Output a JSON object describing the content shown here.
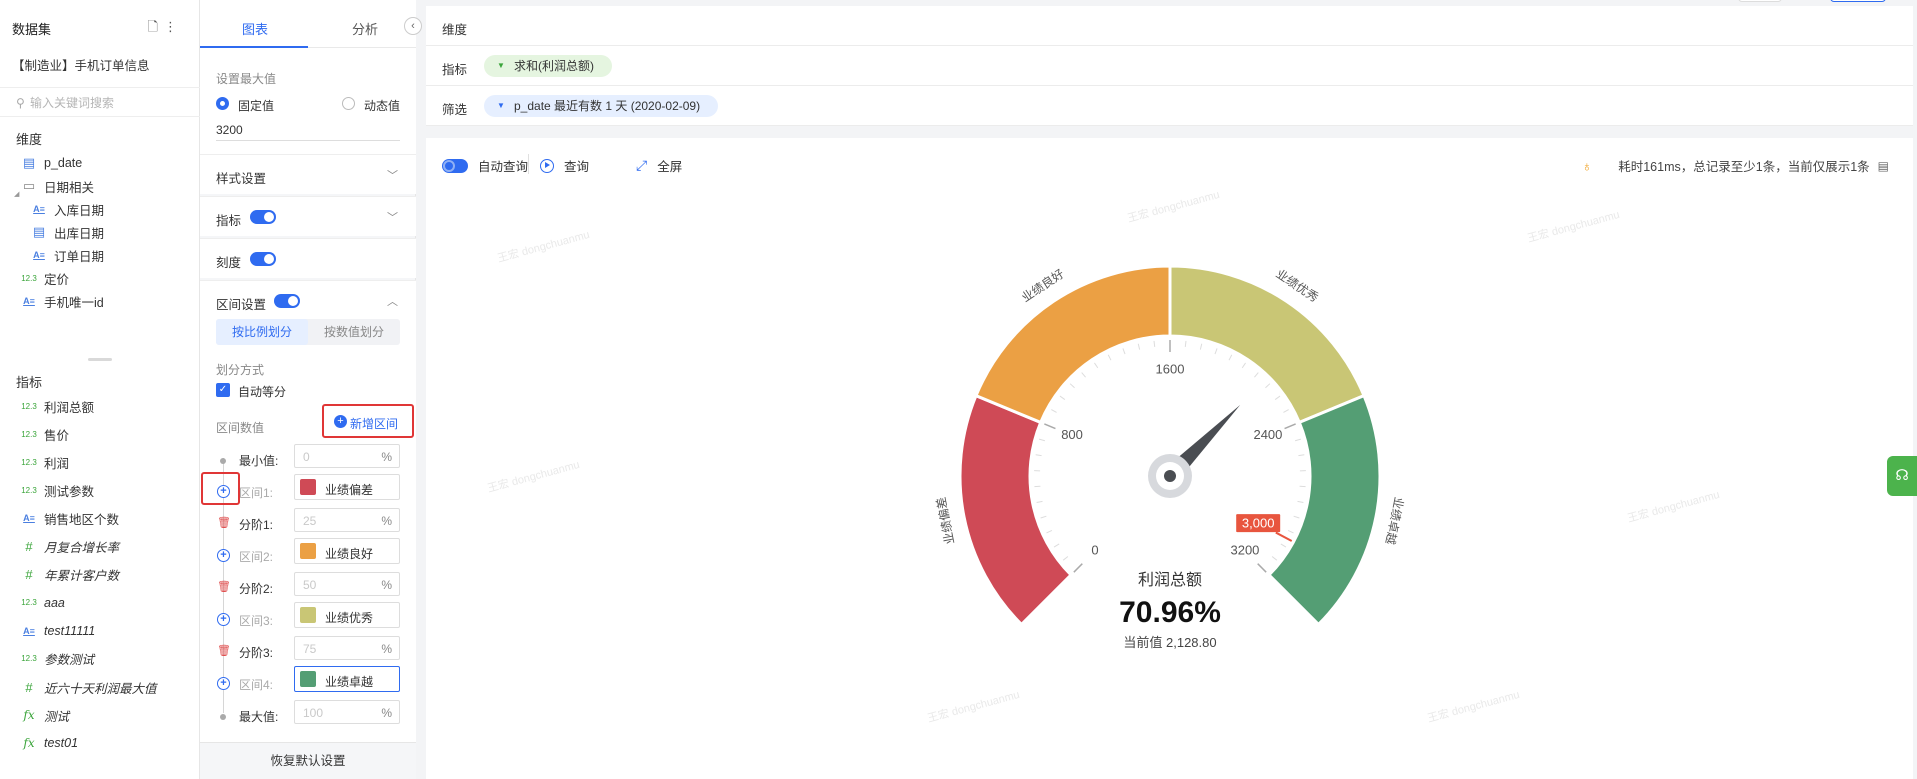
{
  "left_panel": {
    "title": "数据集",
    "dataset_name": "【制造业】手机订单信息",
    "search_placeholder": "输入关键词搜索",
    "dimensions_label": "维度",
    "dimensions": [
      {
        "label": "p_date",
        "icon": "date-icon"
      },
      {
        "label": "日期相关",
        "icon": "folder-icon"
      },
      {
        "label": "入库日期",
        "icon": "string-field-icon"
      },
      {
        "label": "出库日期",
        "icon": "date-icon"
      },
      {
        "label": "订单日期",
        "icon": "string-field-icon"
      },
      {
        "label": "定价",
        "icon": "number-field-icon"
      },
      {
        "label": "手机唯一id",
        "icon": "string-field-icon"
      }
    ],
    "measures_label": "指标",
    "measures": [
      {
        "label": "利润总额",
        "icon": "number-field-icon"
      },
      {
        "label": "售价",
        "icon": "number-field-icon"
      },
      {
        "label": "利润",
        "icon": "number-field-icon"
      },
      {
        "label": "测试参数",
        "icon": "number-field-icon"
      },
      {
        "label": "销售地区个数",
        "icon": "string-field-icon"
      },
      {
        "label": "月复合增长率",
        "icon": "hash-icon"
      },
      {
        "label": "年累计客户数",
        "icon": "hash-icon"
      },
      {
        "label": "aaa",
        "icon": "number-field-icon"
      },
      {
        "label": "test11111",
        "icon": "string-field-icon"
      },
      {
        "label": "参数测试",
        "icon": "number-field-icon"
      },
      {
        "label": "近六十天利润最大值",
        "icon": "hash-icon"
      },
      {
        "label": "测试",
        "icon": "fx-icon"
      },
      {
        "label": "test01",
        "icon": "fx-icon"
      }
    ],
    "icon_glyphs": {
      "number": "12.3",
      "string": "A≡",
      "fx": "fx",
      "hash": "#",
      "date": "▤",
      "folder": "▭"
    }
  },
  "config_panel": {
    "tabs": [
      "图表",
      "分析"
    ],
    "max_value_label": "设置最大值",
    "fixed_label": "固定值",
    "dynamic_label": "动态值",
    "max_value": "3200",
    "style_settings": "样式设置",
    "indicator": "指标",
    "scale": "刻度",
    "range_settings": "区间设置",
    "split_by_ratio": "按比例划分",
    "split_by_value": "按数值划分",
    "split_method": "划分方式",
    "auto_equal": "自动等分",
    "range_values": "区间数值",
    "add_range": "新增区间",
    "rows": [
      {
        "kind": "bound",
        "label": "最小值:",
        "value": "0",
        "unit": "%"
      },
      {
        "kind": "range",
        "label": "区间1:",
        "name": "业绩偏差",
        "color": "#cf4a56"
      },
      {
        "kind": "step",
        "label": "分阶1:",
        "value": "25",
        "unit": "%"
      },
      {
        "kind": "range",
        "label": "区间2:",
        "name": "业绩良好",
        "color": "#eba044"
      },
      {
        "kind": "step",
        "label": "分阶2:",
        "value": "50",
        "unit": "%"
      },
      {
        "kind": "range",
        "label": "区间3:",
        "name": "业绩优秀",
        "color": "#c9c675"
      },
      {
        "kind": "step",
        "label": "分阶3:",
        "value": "75",
        "unit": "%"
      },
      {
        "kind": "range",
        "label": "区间4:",
        "name": "业绩卓越",
        "color": "#549e74"
      },
      {
        "kind": "bound",
        "label": "最大值:",
        "value": "100",
        "unit": "%"
      }
    ],
    "reset": "恢复默认设置"
  },
  "main": {
    "dimension_label": "维度",
    "measure_label": "指标",
    "measure_pill": "求和(利润总额)",
    "filter_label": "筛选",
    "filter_pill": "p_date 最近有数 1 天 (2020-02-09)",
    "auto_query": "自动查询",
    "query": "查询",
    "fullscreen": "全屏",
    "info": "耗时161ms，总记录至少1条，当前仅展示1条",
    "watermark": "王宏 dongchuanmu"
  },
  "chart_data": {
    "type": "gauge",
    "min": 0,
    "max": 3200,
    "ticks": [
      0,
      800,
      1600,
      2400,
      3200
    ],
    "value": 2128.8,
    "marker_value": 3000,
    "marker_label": "3,000",
    "metric_name": "利润总额",
    "percent_label": "70.96%",
    "current_label": "当前值 2,128.80",
    "bands": [
      {
        "label": "业绩偏差",
        "from": 0,
        "to": 800,
        "color": "#cf4a56"
      },
      {
        "label": "业绩良好",
        "from": 800,
        "to": 1600,
        "color": "#eba044"
      },
      {
        "label": "业绩优秀",
        "from": 1600,
        "to": 2400,
        "color": "#c9c675"
      },
      {
        "label": "业绩卓越",
        "from": 2400,
        "to": 3200,
        "color": "#549e74"
      }
    ]
  }
}
